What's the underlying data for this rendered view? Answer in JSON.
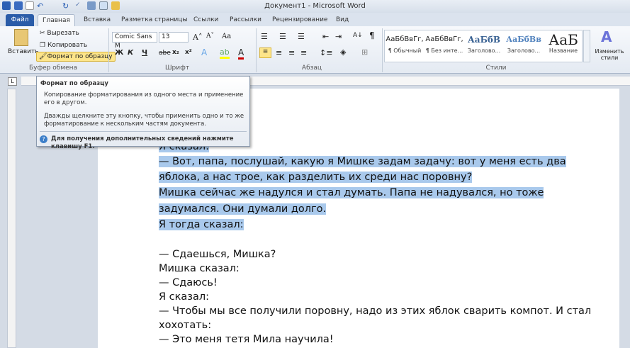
{
  "title": "Документ1 - Microsoft Word",
  "tabs": [
    "Файл",
    "Главная",
    "Вставка",
    "Разметка страницы",
    "Ссылки",
    "Рассылки",
    "Рецензирование",
    "Вид"
  ],
  "clipboard": {
    "paste": "Вставить",
    "cut": "Вырезать",
    "copy": "Копировать",
    "format_painter": "Формат по образцу",
    "label": "Буфер обмена"
  },
  "font": {
    "name": "Comic Sans M",
    "size": "13",
    "bold": "Ж",
    "italic": "К",
    "underline": "Ч",
    "strike": "abe",
    "sub": "x₂",
    "sup": "x²",
    "grow": "A˄",
    "shrink": "A˅",
    "case": "Aa",
    "label": "Шрифт"
  },
  "paragraph": {
    "label": "Абзац",
    "pilcrow": "¶",
    "sort": "A↓"
  },
  "styles": {
    "label": "Стили",
    "items": [
      {
        "preview": "АаБбВвГг,",
        "name": "¶ Обычный"
      },
      {
        "preview": "АаБбВвГг,",
        "name": "¶ Без инте..."
      },
      {
        "preview": "АаБбВ",
        "name": "Заголово..."
      },
      {
        "preview": "АаБбВв",
        "name": "Заголово..."
      },
      {
        "preview": "АаБ",
        "name": "Название"
      }
    ],
    "change": "Изменить стили"
  },
  "tooltip": {
    "title": "Формат по образцу",
    "p1": "Копирование форматирования из одного места и применение его в другом.",
    "p2": "Дважды щелкните эту кнопку, чтобы применить одно и то же форматирование к нескольким частям документа.",
    "help": "Для получения дополнительных сведений нажмите клавишу F1."
  },
  "document": {
    "lines": [
      {
        "text": "Я сказал:",
        "selected": true
      },
      {
        "text": "— Вот, папа, послушай, какую я Мишке задам задачу: вот у меня есть два",
        "selected": true
      },
      {
        "text": "яблока, а нас трое, как разделить их среди нас поровну?",
        "selected": true
      },
      {
        "text": "Мишка сейчас же надулся и стал думать. Папа не надувался, но тоже",
        "selected": true
      },
      {
        "text": "задумался. Они думали долго.",
        "selected": true
      },
      {
        "text": "Я тогда сказал:",
        "selected": true
      },
      {
        "text": "— Сдаешься, Мишка?",
        "selected": false
      },
      {
        "text": "Мишка сказал:",
        "selected": false
      },
      {
        "text": "— Сдаюсь!",
        "selected": false
      },
      {
        "text": "Я сказал:",
        "selected": false
      },
      {
        "text": "— Чтобы мы все получили поровну, надо из этих яблок сварить компот. И стал",
        "selected": false
      },
      {
        "text": "хохотать:",
        "selected": false
      },
      {
        "text": "— Это меня тетя Мила научила!",
        "selected": false
      }
    ]
  }
}
